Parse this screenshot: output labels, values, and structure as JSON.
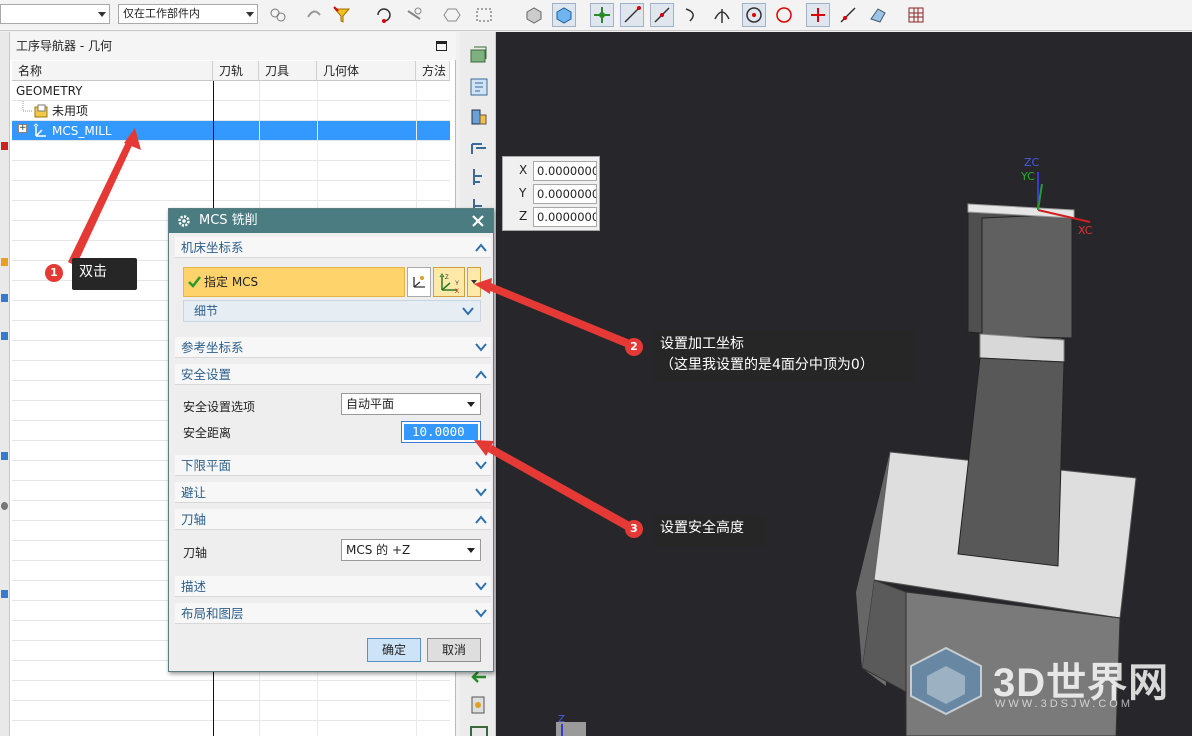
{
  "toolbar": {
    "combo1_value": "",
    "combo2_value": "仅在工作部件内"
  },
  "navigator": {
    "title": "工序导航器 - 几何",
    "columns": [
      "名称",
      "刀轨",
      "刀具",
      "几何体",
      "方法"
    ],
    "rows": [
      {
        "label": "GEOMETRY"
      },
      {
        "label": "未用项"
      },
      {
        "label": "MCS_MILL"
      }
    ]
  },
  "coords": [
    {
      "axis": "X",
      "value": "0.0000000"
    },
    {
      "axis": "Y",
      "value": "0.0000000"
    },
    {
      "axis": "Z",
      "value": "0.0000000"
    }
  ],
  "dialog": {
    "title": "MCS 铣削",
    "sections": {
      "machine_csys": "机床坐标系",
      "ref_csys": "参考坐标系",
      "clearance": "安全设置",
      "lower_limit": "下限平面",
      "avoidance": "避让",
      "tool_axis": "刀轴",
      "description": "描述",
      "layout": "布局和图层"
    },
    "specify_mcs": "指定 MCS",
    "details": "细节",
    "clearance_option_label": "安全设置选项",
    "clearance_option_value": "自动平面",
    "clearance_distance_label": "安全距离",
    "clearance_distance_value": "10.0000",
    "tool_axis_label": "刀轴",
    "tool_axis_value": "MCS 的 +Z",
    "ok": "确定",
    "cancel": "取消"
  },
  "viewport": {
    "axis_zc": "ZC",
    "axis_yc": "YC",
    "axis_xc": "XC",
    "axis_z": "Z"
  },
  "annotations": [
    {
      "number": "1",
      "text": "双击"
    },
    {
      "number": "2",
      "line1": "设置加工坐标",
      "line2": "（这里我设置的是4面分中顶为0）"
    },
    {
      "number": "3",
      "text": "设置安全高度"
    }
  ],
  "watermark": {
    "brand": "3D世界网",
    "url": "WWW.3DSJW.COM"
  }
}
